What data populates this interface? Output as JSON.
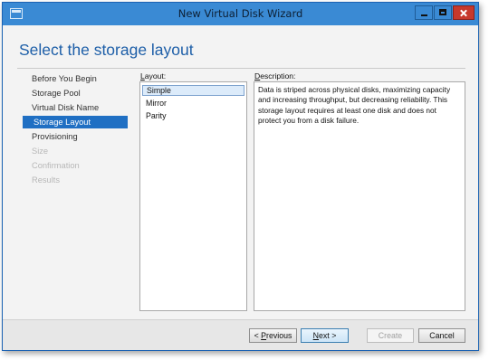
{
  "window": {
    "title": "New Virtual Disk Wizard"
  },
  "page": {
    "heading": "Select the storage layout"
  },
  "nav": {
    "items": [
      {
        "label": "Before You Begin",
        "state": "normal"
      },
      {
        "label": "Storage Pool",
        "state": "normal"
      },
      {
        "label": "Virtual Disk Name",
        "state": "normal"
      },
      {
        "label": "Storage Layout",
        "state": "active"
      },
      {
        "label": "Provisioning",
        "state": "normal"
      },
      {
        "label": "Size",
        "state": "disabled"
      },
      {
        "label": "Confirmation",
        "state": "disabled"
      },
      {
        "label": "Results",
        "state": "disabled"
      }
    ]
  },
  "layout": {
    "label_first": "L",
    "label_rest": "ayout:",
    "options": [
      "Simple",
      "Mirror",
      "Parity"
    ],
    "selected": "Simple"
  },
  "description": {
    "label_first": "D",
    "label_rest": "escription:",
    "text": "Data is striped across physical disks, maximizing capacity and increasing throughput, but decreasing reliability. This storage layout requires at least one disk and does not protect you from a disk failure."
  },
  "buttons": {
    "previous_prefix": "< ",
    "previous_key": "P",
    "previous_rest": "revious",
    "next_key": "N",
    "next_rest": "ext >",
    "create": "Create",
    "cancel": "Cancel"
  },
  "colors": {
    "titlebar": "#3a8ad4",
    "accent": "#1f6fc3",
    "heading": "#1e5fa8",
    "close": "#c7392c"
  }
}
